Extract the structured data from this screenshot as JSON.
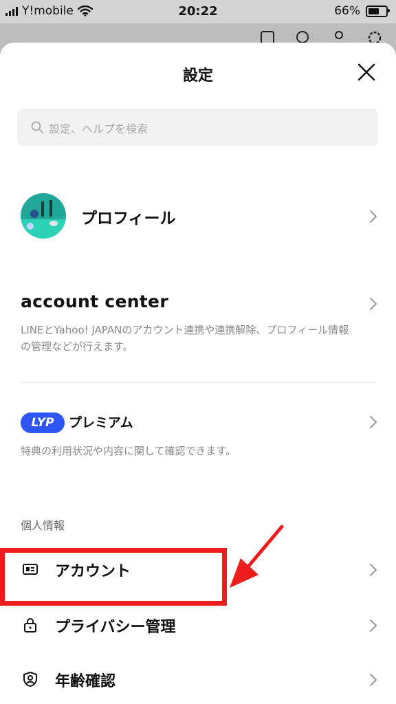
{
  "status": {
    "carrier": "Y!mobile",
    "time": "20:22",
    "battery": "66%",
    "battery_level": 0.66
  },
  "sheet": {
    "title": "設定",
    "search_placeholder": "設定、ヘルプを検索",
    "profile": {
      "label": "プロフィール"
    },
    "account_center": {
      "title": "account center",
      "description": "LINEとYahoo! JAPANのアカウント連携や連携解除、プロフィール情報の管理などが行えます。"
    },
    "lyp": {
      "badge": "LYP",
      "label": "プレミアム",
      "description": "特典の利用状況や内容に関して確認できます。"
    },
    "section_personal": "個人情報",
    "items": [
      {
        "label": "アカウント",
        "icon": "id-card-icon"
      },
      {
        "label": "プライバシー管理",
        "icon": "lock-icon"
      },
      {
        "label": "年齢確認",
        "icon": "shield-person-icon"
      }
    ]
  },
  "colors": {
    "accent": "#2f55f4",
    "annotation": "#ee1d1d"
  }
}
